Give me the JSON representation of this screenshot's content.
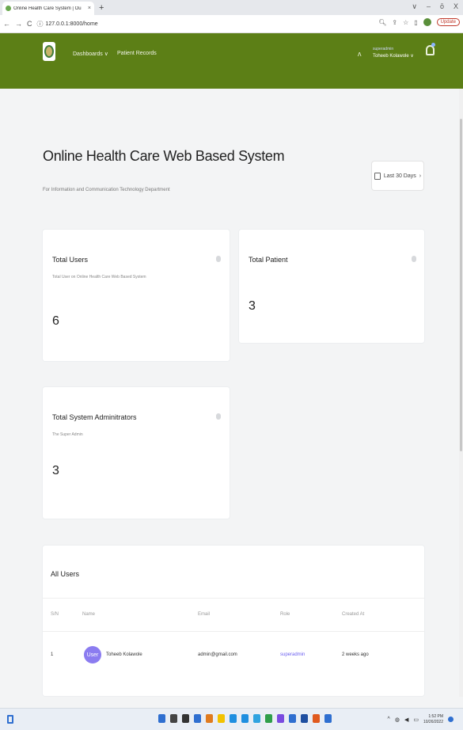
{
  "browser": {
    "tab_title": "Online Health Care System | Ou",
    "tab_close": "×",
    "new_tab": "+",
    "window_controls": [
      "∨",
      "–",
      "ō",
      "X"
    ],
    "url": "127.0.0.1:8000/home",
    "update_label": "Update"
  },
  "navbar": {
    "menu": [
      "Dashboards ∨",
      "Patient Records"
    ],
    "user_role": "superadmin",
    "user_name": "Toheeb Kolawole ∨"
  },
  "header": {
    "title": "Online Health Care Web Based System",
    "subtitle": "For Information and Communication Technology Department",
    "range_button": "Last 30 Days"
  },
  "cards": {
    "users": {
      "title": "Total Users",
      "subtitle": "Total User on Online Health Care Web Based System",
      "value": "6"
    },
    "patients": {
      "title": "Total Patient",
      "value": "3"
    },
    "admins": {
      "title": "Total System Adminitrators",
      "subtitle": "The Super Admin",
      "value": "3"
    }
  },
  "table": {
    "title": "All Users",
    "headers": [
      "S/N",
      "Name",
      "Email",
      "Role",
      "Created At"
    ],
    "rows": [
      {
        "sn": "1",
        "avatar": "User",
        "name": "Toheeb Kolawole",
        "email": "admin@gmail.com",
        "role": "superadmin",
        "created": "2 weeks ago"
      }
    ]
  },
  "taskbar": {
    "time": "1:52 PM",
    "date": "10/26/2022",
    "icon_colors": [
      "#2f6fd0",
      "#444444",
      "#333333",
      "#2f6fd0",
      "#e07b1f",
      "#f2c200",
      "#1f8fe0",
      "#1f8fe0",
      "#2fa3e0",
      "#2e9e4a",
      "#7a4be0",
      "#2f6fd0",
      "#1f4fa0",
      "#e05a1f",
      "#2f6fd0"
    ]
  }
}
